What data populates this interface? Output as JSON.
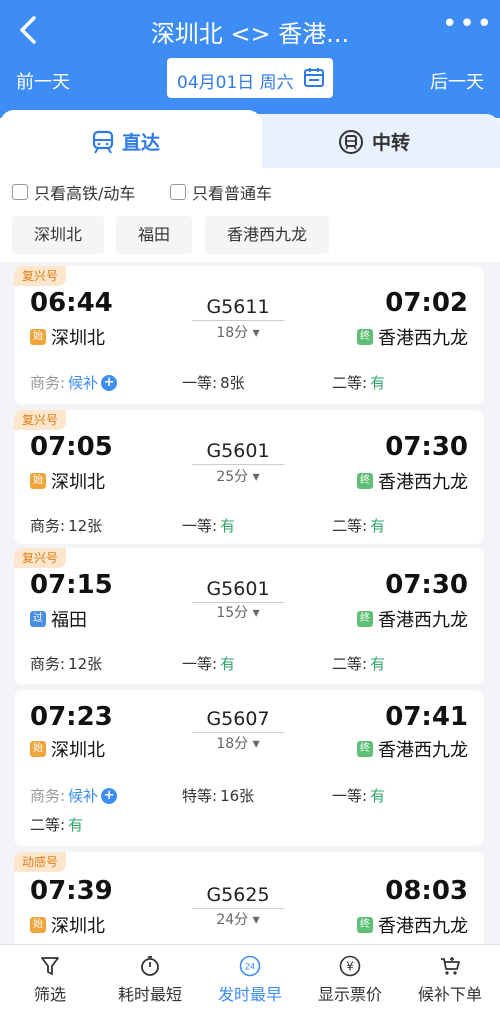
{
  "header": {
    "title": "深圳北 <> 香港...",
    "prev_day": "前一天",
    "next_day": "后一天",
    "date": "04月01日 周六"
  },
  "tabs": {
    "direct": "直达",
    "transfer": "中转"
  },
  "filters": {
    "high_speed_only": "只看高铁/动车",
    "normal_only": "只看普通车",
    "stations": [
      "深圳北",
      "福田",
      "香港西九龙"
    ]
  },
  "trains": [
    {
      "tag": "复兴号",
      "dep_time": "06:44",
      "arr_time": "07:02",
      "train_no": "G5611",
      "duration": "18分",
      "dep_station": "深圳北",
      "dep_badge": "始",
      "arr_station": "香港西九龙",
      "arr_badge": "终",
      "seats": [
        {
          "label": "商务:",
          "value": "候补"
        },
        {
          "label": "一等:",
          "value": "8张"
        },
        {
          "label": "二等:",
          "value": "有"
        }
      ]
    },
    {
      "tag": "复兴号",
      "dep_time": "07:05",
      "arr_time": "07:30",
      "train_no": "G5601",
      "duration": "25分",
      "dep_station": "深圳北",
      "dep_badge": "始",
      "arr_station": "香港西九龙",
      "arr_badge": "终",
      "seats": [
        {
          "label": "商务:",
          "value": "12张"
        },
        {
          "label": "一等:",
          "value": "有"
        },
        {
          "label": "二等:",
          "value": "有"
        }
      ]
    },
    {
      "tag": "复兴号",
      "dep_time": "07:15",
      "arr_time": "07:30",
      "train_no": "G5601",
      "duration": "15分",
      "dep_station": "福田",
      "dep_badge": "过",
      "arr_station": "香港西九龙",
      "arr_badge": "终",
      "seats": [
        {
          "label": "商务:",
          "value": "12张"
        },
        {
          "label": "一等:",
          "value": "有"
        },
        {
          "label": "二等:",
          "value": "有"
        }
      ]
    },
    {
      "tag": "",
      "dep_time": "07:23",
      "arr_time": "07:41",
      "train_no": "G5607",
      "duration": "18分",
      "dep_station": "深圳北",
      "dep_badge": "始",
      "arr_station": "香港西九龙",
      "arr_badge": "终",
      "seats": [
        {
          "label": "商务:",
          "value": "候补"
        },
        {
          "label": "特等:",
          "value": "16张"
        },
        {
          "label": "一等:",
          "value": "有"
        },
        {
          "label": "二等:",
          "value": "有"
        }
      ]
    },
    {
      "tag": "动感号",
      "dep_time": "07:39",
      "arr_time": "08:03",
      "train_no": "G5625",
      "duration": "24分",
      "dep_station": "深圳北",
      "dep_badge": "始",
      "arr_station": "香港西九龙",
      "arr_badge": "终",
      "seats": []
    }
  ],
  "bottom_bar": {
    "filter": "筛选",
    "shortest": "耗时最短",
    "earliest": "发时最早",
    "earliest_icon_text": "24",
    "show_price": "显示票价",
    "price_icon_text": "¥",
    "waitlist": "候补下单"
  },
  "colors": {
    "primary": "#3d8df5",
    "available": "#35a46b",
    "tag_bg": "#fde7cc",
    "tag_text": "#e07d1a"
  }
}
